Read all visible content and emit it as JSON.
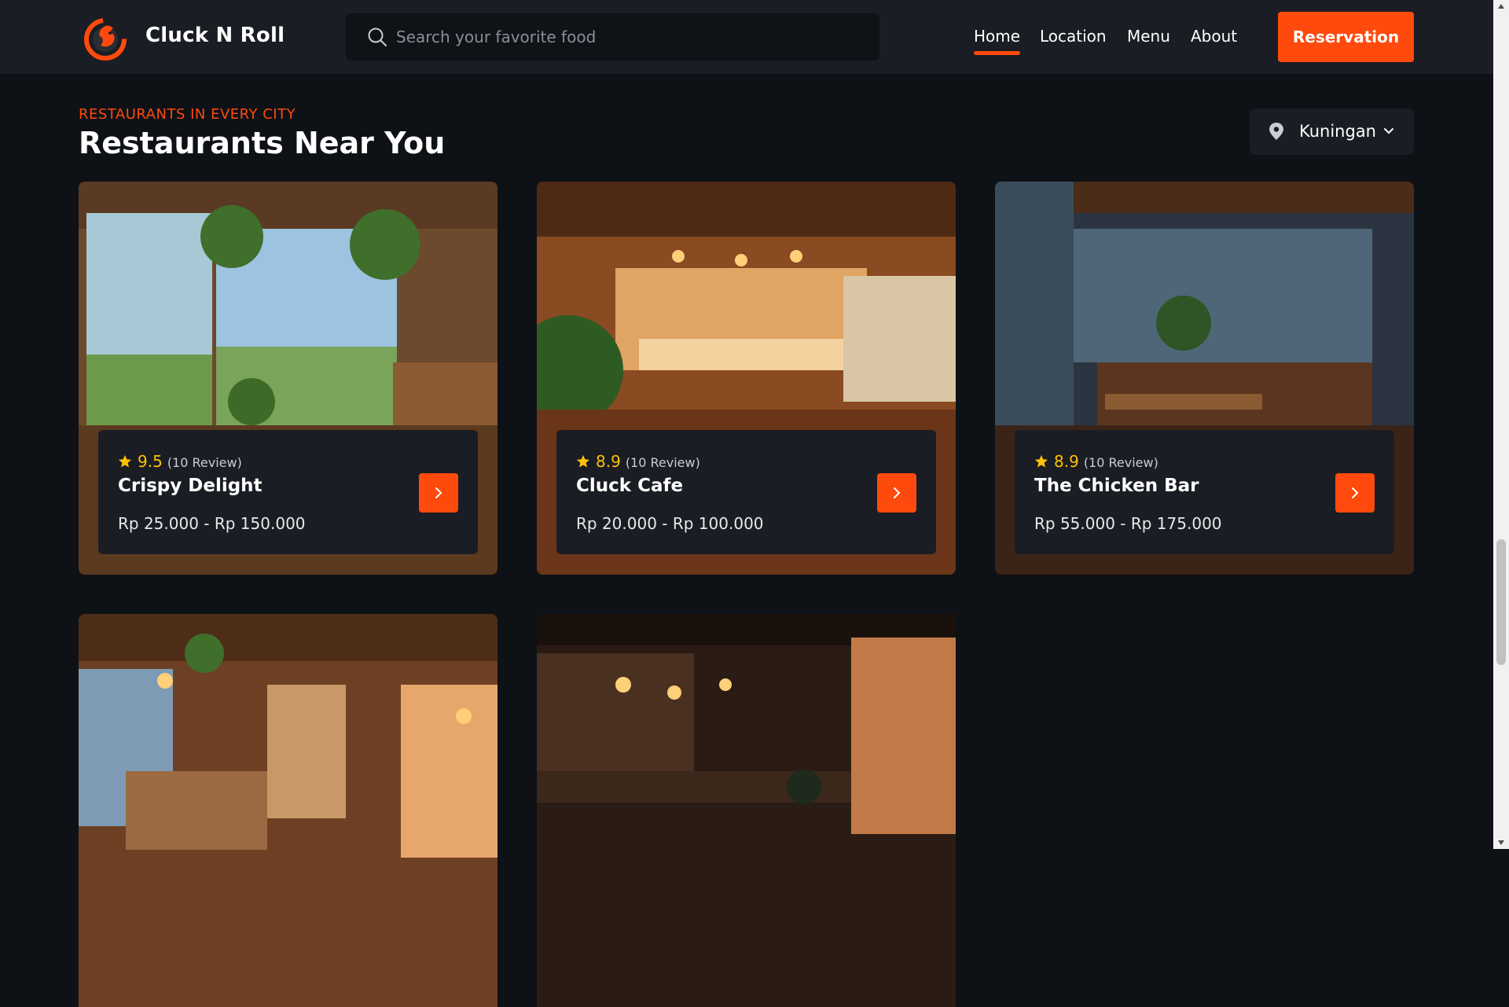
{
  "header": {
    "brand": "Cluck N Roll",
    "search_placeholder": "Search your favorite food",
    "nav": [
      "Home",
      "Location",
      "Menu",
      "About"
    ],
    "active_nav": "Home",
    "reservation_label": "Reservation"
  },
  "section": {
    "eyebrow": "RESTAURANTS IN EVERY CITY",
    "title": "Restaurants Near You",
    "location": "Kuningan"
  },
  "restaurants": [
    {
      "rating": "9.5",
      "reviews": "(10 Review)",
      "name": "Crispy Delight",
      "price": "Rp 25.000 - Rp 150.000"
    },
    {
      "rating": "8.9",
      "reviews": "(10 Review)",
      "name": "Cluck Cafe",
      "price": "Rp 20.000 - Rp 100.000"
    },
    {
      "rating": "8.9",
      "reviews": "(10 Review)",
      "name": "The Chicken Bar",
      "price": "Rp 55.000 - Rp 175.000"
    },
    {},
    {}
  ],
  "colors": {
    "accent": "#ff4a0d",
    "background": "#0e1116",
    "surface": "#1a1d23",
    "star": "#ffc107"
  }
}
